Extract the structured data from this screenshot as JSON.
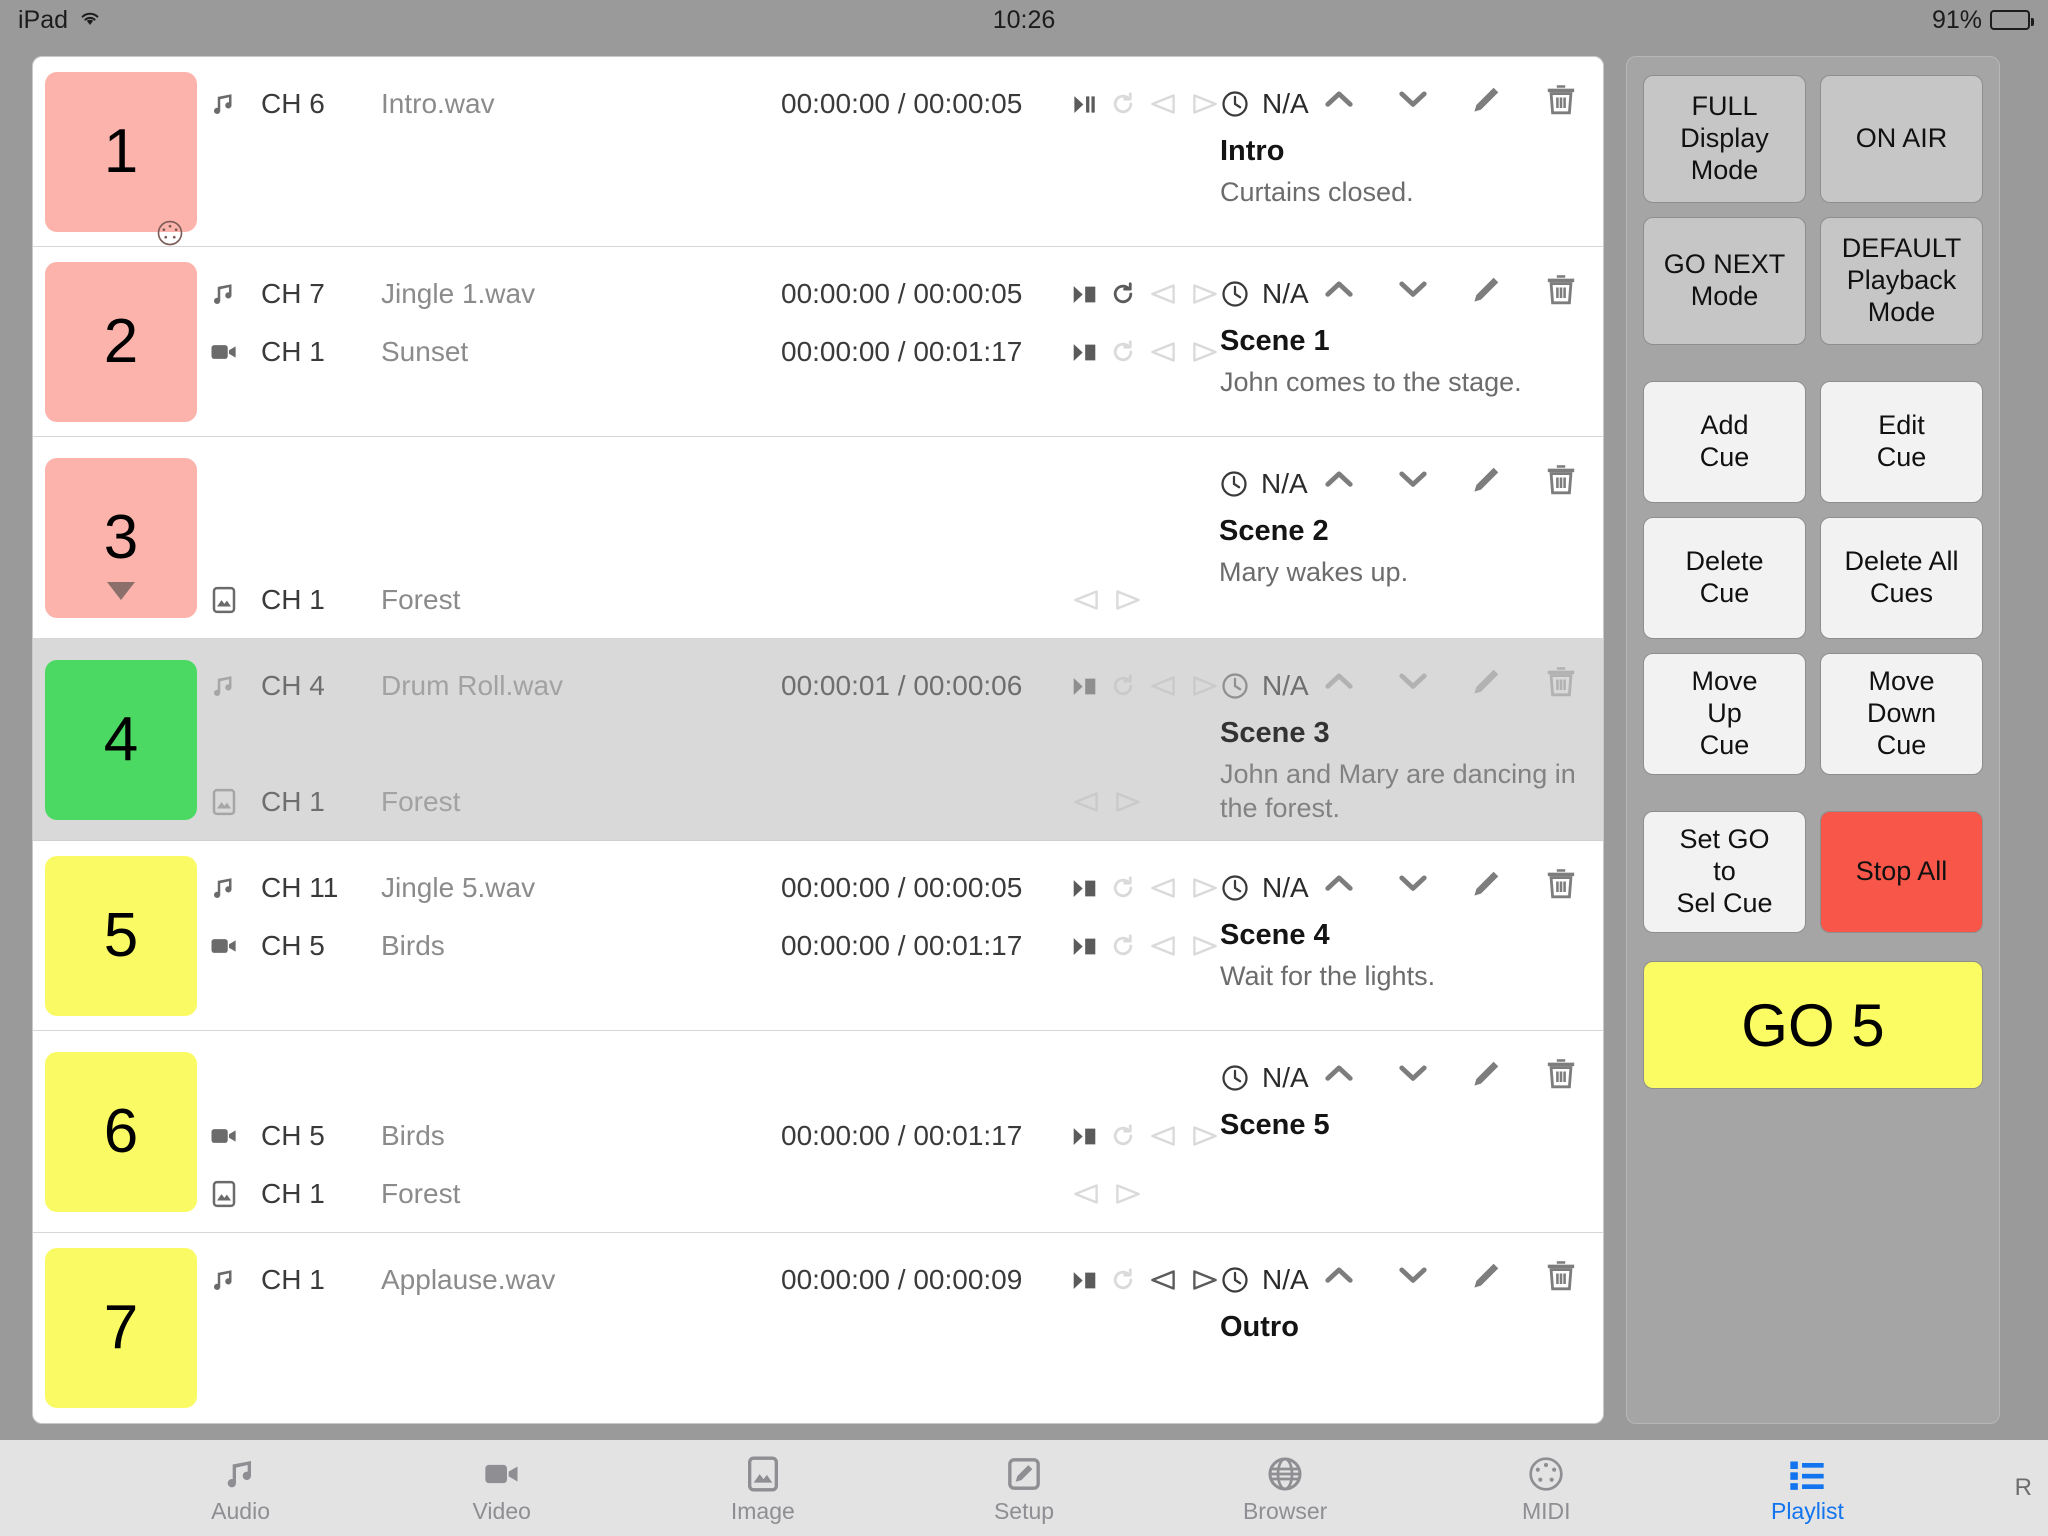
{
  "status_bar": {
    "device": "iPad",
    "wifi_icon": "wifi-icon",
    "time": "10:26",
    "battery_percent": "91%",
    "battery_icon": "battery-icon"
  },
  "playlist": {
    "cues": [
      {
        "number": "1",
        "color": "#fcb3ab",
        "selected": false,
        "has_midi_badge": true,
        "has_triangle_badge": false,
        "tracks": [
          {
            "type": "audio",
            "icon": "music-note-icon",
            "channel": "CH 6",
            "name": "Intro.wav",
            "time": "00:00:00 / 00:00:05",
            "show_transport": true,
            "play_mode": "play-pause",
            "loop_active": false,
            "fade_in_active": false,
            "fade_out_active": false,
            "row": "top"
          }
        ],
        "wait_time": "N/A",
        "scene_title": "Intro",
        "scene_desc": "Curtains closed."
      },
      {
        "number": "2",
        "color": "#fcb3ab",
        "selected": false,
        "has_midi_badge": false,
        "has_triangle_badge": false,
        "tracks": [
          {
            "type": "audio",
            "icon": "music-note-icon",
            "channel": "CH 7",
            "name": "Jingle 1.wav",
            "time": "00:00:00 / 00:00:05",
            "show_transport": true,
            "play_mode": "play-stop",
            "loop_active": true,
            "fade_in_active": false,
            "fade_out_active": false,
            "row": "top"
          },
          {
            "type": "video",
            "icon": "video-camera-icon",
            "channel": "CH 1",
            "name": "Sunset",
            "time": "00:00:00 / 00:01:17",
            "show_transport": true,
            "play_mode": "play-stop",
            "loop_active": false,
            "fade_in_active": false,
            "fade_out_active": false,
            "row": "mid"
          }
        ],
        "wait_time": "N/A",
        "scene_title": "Scene 1",
        "scene_desc": "John comes to the stage."
      },
      {
        "number": "3",
        "color": "#fcb3ab",
        "selected": false,
        "has_midi_badge": false,
        "has_triangle_badge": true,
        "tracks": [
          {
            "type": "spacer",
            "icon": "",
            "channel": "",
            "name": "",
            "time": "",
            "show_transport": false,
            "row": "top"
          },
          {
            "type": "spacer2",
            "icon": "",
            "channel": "",
            "name": "",
            "time": "",
            "show_transport": false,
            "row": "mid"
          },
          {
            "type": "image",
            "icon": "image-icon",
            "channel": "CH 1",
            "name": "Forest",
            "time": "",
            "show_transport": true,
            "play_mode": "none",
            "loop_active": false,
            "fade_in_active": false,
            "fade_out_active": false,
            "row": "bottom"
          }
        ],
        "wait_time": "N/A",
        "scene_title": "Scene 2",
        "scene_desc": "Mary wakes up."
      },
      {
        "number": "4",
        "color": "#4bd964",
        "selected": true,
        "has_midi_badge": false,
        "has_triangle_badge": false,
        "tracks": [
          {
            "type": "audio",
            "icon": "music-note-icon",
            "channel": "CH 4",
            "name": "Drum Roll.wav",
            "time": "00:00:01 / 00:00:06",
            "show_transport": true,
            "play_mode": "play-stop",
            "loop_active": false,
            "fade_in_active": false,
            "fade_out_active": false,
            "row": "top"
          },
          {
            "type": "spacer2",
            "icon": "",
            "channel": "",
            "name": "",
            "time": "",
            "show_transport": false,
            "row": "mid"
          },
          {
            "type": "image",
            "icon": "image-icon",
            "channel": "CH 1",
            "name": "Forest",
            "time": "",
            "show_transport": true,
            "play_mode": "none",
            "loop_active": false,
            "fade_in_active": false,
            "fade_out_active": false,
            "row": "bottom"
          }
        ],
        "wait_time": "N/A",
        "scene_title": "Scene 3",
        "scene_desc": "John and Mary are dancing in the forest."
      },
      {
        "number": "5",
        "color": "#fafa64",
        "selected": false,
        "has_midi_badge": false,
        "has_triangle_badge": false,
        "tracks": [
          {
            "type": "audio",
            "icon": "music-note-icon",
            "channel": "CH 11",
            "name": "Jingle 5.wav",
            "time": "00:00:00 / 00:00:05",
            "show_transport": true,
            "play_mode": "play-stop",
            "loop_active": false,
            "fade_in_active": false,
            "fade_out_active": false,
            "row": "top"
          },
          {
            "type": "video",
            "icon": "video-camera-icon",
            "channel": "CH 5",
            "name": "Birds",
            "time": "00:00:00 / 00:01:17",
            "show_transport": true,
            "play_mode": "play-stop",
            "loop_active": false,
            "fade_in_active": false,
            "fade_out_active": false,
            "row": "mid"
          }
        ],
        "wait_time": "N/A",
        "scene_title": "Scene 4",
        "scene_desc": "Wait for the lights."
      },
      {
        "number": "6",
        "color": "#fafa64",
        "selected": false,
        "has_midi_badge": false,
        "has_triangle_badge": false,
        "tracks": [
          {
            "type": "spacer",
            "icon": "",
            "channel": "",
            "name": "",
            "time": "",
            "show_transport": false,
            "row": "top"
          },
          {
            "type": "video",
            "icon": "video-camera-icon",
            "channel": "CH 5",
            "name": "Birds",
            "time": "00:00:00 / 00:01:17",
            "show_transport": true,
            "play_mode": "play-stop",
            "loop_active": false,
            "fade_in_active": false,
            "fade_out_active": false,
            "row": "mid"
          },
          {
            "type": "image",
            "icon": "image-icon",
            "channel": "CH 1",
            "name": "Forest",
            "time": "",
            "show_transport": true,
            "play_mode": "none",
            "loop_active": false,
            "fade_in_active": false,
            "fade_out_active": false,
            "row": "bottom"
          }
        ],
        "wait_time": "N/A",
        "scene_title": "Scene 5",
        "scene_desc": ""
      },
      {
        "number": "7",
        "color": "#fafa64",
        "selected": false,
        "has_midi_badge": false,
        "has_triangle_badge": false,
        "tracks": [
          {
            "type": "audio",
            "icon": "music-note-icon",
            "channel": "CH 1",
            "name": "Applause.wav",
            "time": "00:00:00 / 00:00:09",
            "show_transport": true,
            "play_mode": "play-stop",
            "loop_active": false,
            "fade_in_active": true,
            "fade_out_active": true,
            "row": "top"
          }
        ],
        "wait_time": "N/A",
        "scene_title": "Outro",
        "scene_desc": ""
      }
    ]
  },
  "sidebar": {
    "mode_buttons": [
      {
        "label": "FULL\nDisplay\nMode",
        "style": "dim"
      },
      {
        "label": "ON AIR",
        "style": "dim"
      },
      {
        "label": "GO NEXT\nMode",
        "style": "dim"
      },
      {
        "label": "DEFAULT\nPlayback\nMode",
        "style": "dim"
      }
    ],
    "action_buttons": [
      {
        "label": "Add\nCue",
        "style": "light"
      },
      {
        "label": "Edit\nCue",
        "style": "light"
      },
      {
        "label": "Delete\nCue",
        "style": "light"
      },
      {
        "label": "Delete All\nCues",
        "style": "light"
      },
      {
        "label": "Move\nUp\nCue",
        "style": "light"
      },
      {
        "label": "Move\nDown\nCue",
        "style": "light"
      }
    ],
    "bottom_buttons": [
      {
        "label": "Set GO\nto\nSel Cue",
        "style": "light"
      },
      {
        "label": "Stop All",
        "style": "red"
      }
    ],
    "go_button": {
      "label": "GO 5",
      "color": "#fbfb63"
    }
  },
  "tab_bar": {
    "tabs": [
      {
        "label": "Audio",
        "icon": "music-note-icon",
        "active": false
      },
      {
        "label": "Video",
        "icon": "video-camera-icon",
        "active": false
      },
      {
        "label": "Image",
        "icon": "image-icon",
        "active": false
      },
      {
        "label": "Setup",
        "icon": "pencil-square-icon",
        "active": false
      },
      {
        "label": "Browser",
        "icon": "globe-icon",
        "active": false
      },
      {
        "label": "MIDI",
        "icon": "midi-din-icon",
        "active": false
      },
      {
        "label": "Playlist",
        "icon": "list-icon",
        "active": true
      }
    ],
    "corner_label": "R"
  }
}
